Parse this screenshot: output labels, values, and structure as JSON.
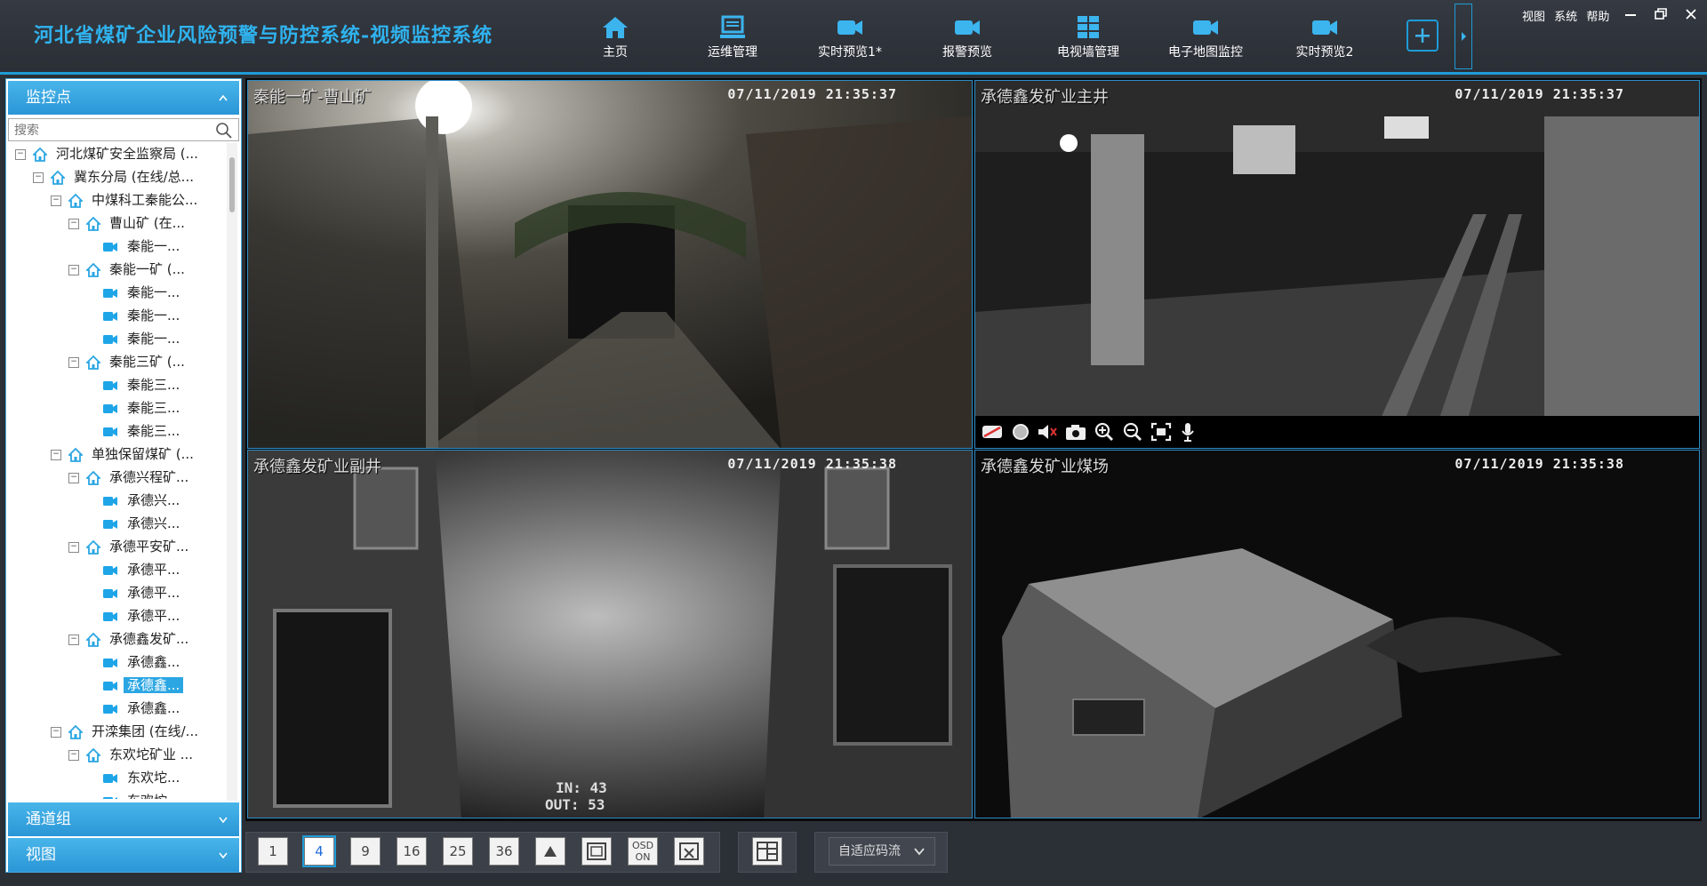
{
  "header": {
    "title": "河北省煤矿企业风险预警与防控系统-视频监控系统",
    "accent_color": "#2fb3ef",
    "nav": [
      {
        "label": "主页",
        "icon": "home-icon"
      },
      {
        "label": "运维管理",
        "icon": "monitor-icon"
      },
      {
        "label": "实时预览1*",
        "icon": "video-camera-icon"
      },
      {
        "label": "报警预览",
        "icon": "video-camera-icon"
      },
      {
        "label": "电视墙管理",
        "icon": "grid-icon"
      },
      {
        "label": "电子地图监控",
        "icon": "video-camera-icon"
      },
      {
        "label": "实时预览2",
        "icon": "video-camera-icon"
      }
    ],
    "active_tab": "实时预览1*",
    "menu": [
      "视图",
      "系统",
      "帮助"
    ]
  },
  "sidebar": {
    "panel_monitor": "监控点",
    "search_placeholder": "搜索",
    "panel_channel_group": "通道组",
    "panel_view": "视图",
    "tree": [
      {
        "label": "河北煤矿安全监察局 (...",
        "level": 0,
        "type": "org"
      },
      {
        "label": "冀东分局 (在线/总...",
        "level": 1,
        "type": "org"
      },
      {
        "label": "中煤科工秦能公...",
        "level": 2,
        "type": "org"
      },
      {
        "label": "曹山矿 (在...",
        "level": 3,
        "type": "org"
      },
      {
        "label": "秦能一...",
        "level": 4,
        "type": "cam"
      },
      {
        "label": "秦能一矿 (...",
        "level": 3,
        "type": "org"
      },
      {
        "label": "秦能一...",
        "level": 4,
        "type": "cam"
      },
      {
        "label": "秦能一...",
        "level": 4,
        "type": "cam"
      },
      {
        "label": "秦能一...",
        "level": 4,
        "type": "cam"
      },
      {
        "label": "秦能三矿 (...",
        "level": 3,
        "type": "org"
      },
      {
        "label": "秦能三...",
        "level": 4,
        "type": "cam"
      },
      {
        "label": "秦能三...",
        "level": 4,
        "type": "cam"
      },
      {
        "label": "秦能三...",
        "level": 4,
        "type": "cam"
      },
      {
        "label": "单独保留煤矿 (...",
        "level": 2,
        "type": "org"
      },
      {
        "label": "承德兴程矿...",
        "level": 3,
        "type": "org"
      },
      {
        "label": "承德兴...",
        "level": 4,
        "type": "cam"
      },
      {
        "label": "承德兴...",
        "level": 4,
        "type": "cam"
      },
      {
        "label": "承德平安矿...",
        "level": 3,
        "type": "org"
      },
      {
        "label": "承德平...",
        "level": 4,
        "type": "cam"
      },
      {
        "label": "承德平...",
        "level": 4,
        "type": "cam"
      },
      {
        "label": "承德平...",
        "level": 4,
        "type": "cam"
      },
      {
        "label": "承德鑫发矿...",
        "level": 3,
        "type": "org"
      },
      {
        "label": "承德鑫...",
        "level": 4,
        "type": "cam"
      },
      {
        "label": "承德鑫...",
        "level": 4,
        "type": "cam",
        "selected": true
      },
      {
        "label": "承德鑫...",
        "level": 4,
        "type": "cam"
      },
      {
        "label": "开滦集团 (在线/...",
        "level": 2,
        "type": "org"
      },
      {
        "label": "东欢坨矿业 ...",
        "level": 3,
        "type": "org"
      },
      {
        "label": "东欢坨...",
        "level": 4,
        "type": "cam"
      },
      {
        "label": "东欢坨...",
        "level": 4,
        "type": "cam"
      }
    ]
  },
  "cameras": [
    {
      "name": "秦能一矿-曹山矿",
      "timestamp": "07/11/2019 21:35:37"
    },
    {
      "name": "承德鑫发矿业主井",
      "timestamp": "07/11/2019 21:35:37"
    },
    {
      "name": "承德鑫发矿业副井",
      "timestamp": "07/11/2019 21:35:38",
      "counter_in": "IN: 43",
      "counter_out": "OUT: 53"
    },
    {
      "name": "承德鑫发矿业煤场",
      "timestamp": "07/11/2019 21:35:38"
    }
  ],
  "bottom": {
    "layouts": [
      "1",
      "4",
      "9",
      "16",
      "25",
      "36"
    ],
    "active_layout": "4",
    "osd_label": "OSD ON",
    "stream_label": "自适应码流"
  }
}
